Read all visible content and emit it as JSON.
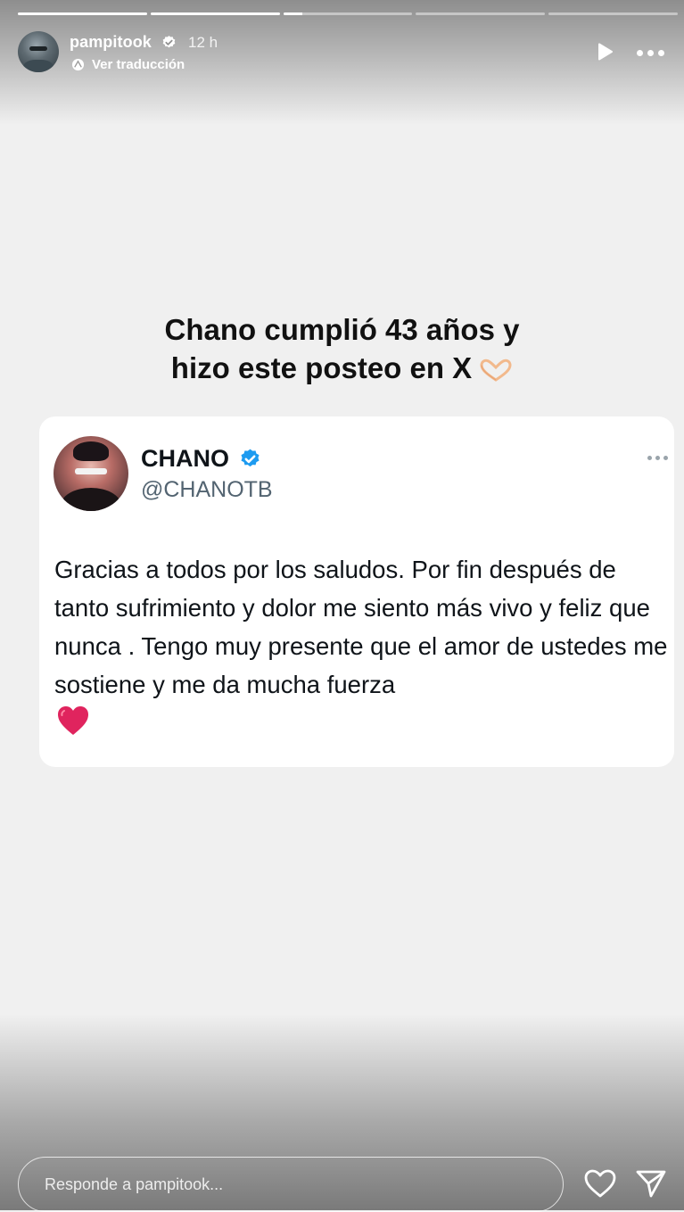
{
  "story": {
    "progress_fill": [
      1,
      1,
      0.15,
      0,
      0
    ],
    "username": "pampitook",
    "verified": true,
    "time": "12 h",
    "translate_label": "Ver traducción",
    "icons": {
      "play": "play-icon",
      "more": "more-options-icon",
      "translate": "translate-icon"
    }
  },
  "content": {
    "headline_line1": "Chano cumplió 43 años y",
    "headline_line2": "hizo este posteo en X",
    "headline_emoji": "heart-hands-icon"
  },
  "tweet": {
    "name": "CHANO",
    "handle": "@CHANOTB",
    "verified": true,
    "text": "Gracias a todos por los saludos. Por fin después de tanto sufrimiento y dolor me siento más vivo y feliz que nunca . Tengo muy presente que el amor de ustedes me sostiene y me da mucha fuerza",
    "emoji": "red-heart-icon"
  },
  "reply": {
    "placeholder": "Responde a pampitook..."
  },
  "colors": {
    "verified_blue": "#1d9bf0",
    "heart_red": "#e0245e",
    "card_bg": "#ffffff",
    "page_bg": "#f0f0f0"
  }
}
